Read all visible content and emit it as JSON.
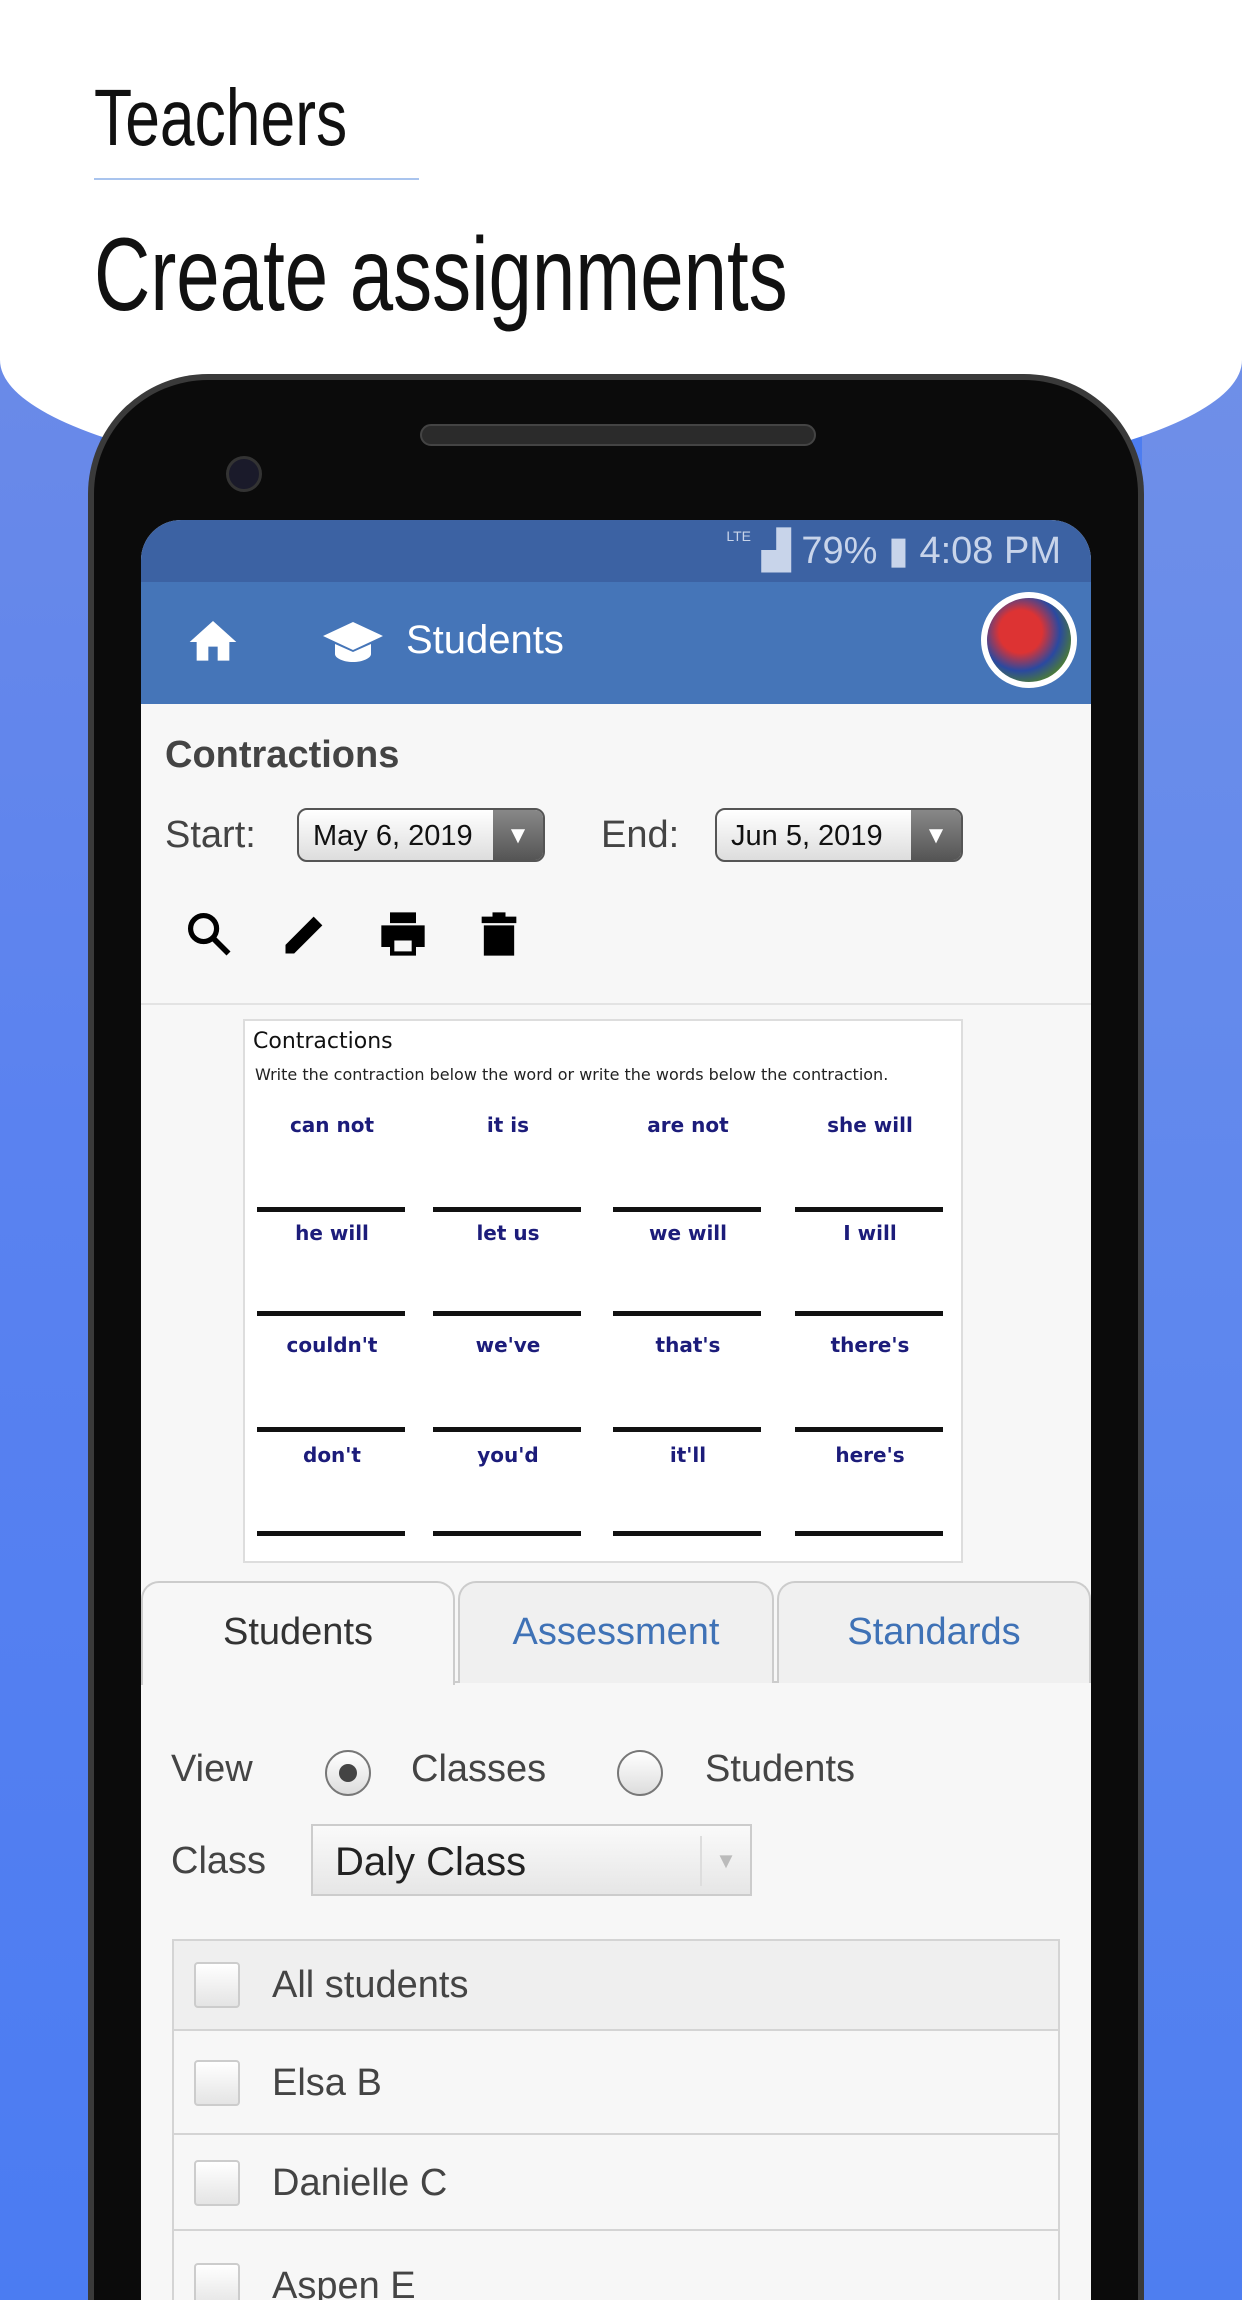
{
  "header": {
    "eyebrow": "Teachers",
    "headline": "Create assignments"
  },
  "colors": {
    "accent": "#4575b8",
    "status_bar": "#3c62a3",
    "background": "#4d7df0",
    "worksheet_text": "#1c1c7a"
  },
  "status_bar": {
    "network": "LTE",
    "battery": "79%",
    "time": "4:08 PM"
  },
  "toolbar": {
    "home_icon": "home-icon",
    "section_icon": "graduation-cap-icon",
    "title": "Students"
  },
  "assignment": {
    "title": "Contractions",
    "start_label": "Start:",
    "start_value": "May 6, 2019",
    "end_label": "End:",
    "end_value": "Jun 5, 2019",
    "actions": [
      "search-icon",
      "pencil-icon",
      "printer-icon",
      "trash-icon"
    ]
  },
  "worksheet": {
    "title": "Contractions",
    "instructions": "Write the contraction below the word or write the words below the contraction.",
    "words": [
      [
        "can not",
        "it is",
        "are not",
        "she will"
      ],
      [
        "he will",
        "let us",
        "we will",
        "I will"
      ],
      [
        "couldn't",
        "we've",
        "that's",
        "there's"
      ],
      [
        "don't",
        "you'd",
        "it'll",
        "here's"
      ]
    ]
  },
  "tabs": [
    {
      "label": "Students",
      "active": true
    },
    {
      "label": "Assessment"
    },
    {
      "label": "Standards"
    }
  ],
  "view": {
    "label": "View",
    "options": [
      {
        "label": "Classes",
        "selected": true
      },
      {
        "label": "Students",
        "selected": false
      }
    ]
  },
  "class": {
    "label": "Class",
    "value": "Daly Class"
  },
  "students": [
    {
      "name": "All students",
      "checked": false
    },
    {
      "name": "Elsa B",
      "checked": false
    },
    {
      "name": "Danielle C",
      "checked": false
    },
    {
      "name": "Aspen E",
      "checked": false
    }
  ]
}
